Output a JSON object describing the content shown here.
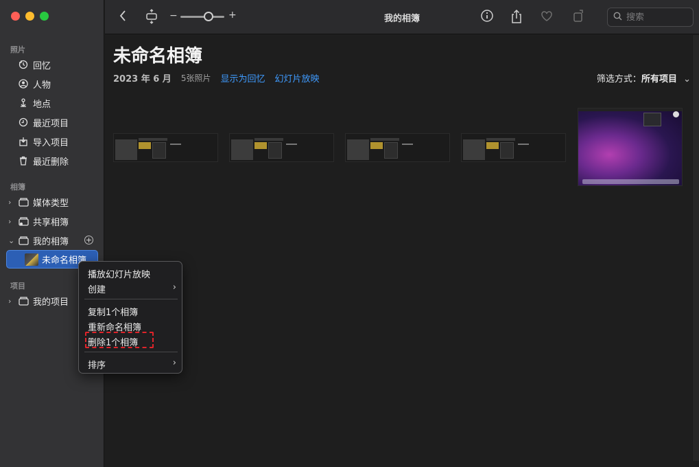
{
  "window": {
    "title": "我的相簿"
  },
  "sidebar": {
    "section_photos": "照片",
    "photos_items": [
      {
        "label": "回忆",
        "icon": "memories-icon"
      },
      {
        "label": "人物",
        "icon": "people-icon"
      },
      {
        "label": "地点",
        "icon": "places-icon"
      },
      {
        "label": "最近项目",
        "icon": "recent-icon"
      },
      {
        "label": "导入项目",
        "icon": "import-icon"
      },
      {
        "label": "最近删除",
        "icon": "trash-icon"
      }
    ],
    "section_albums": "相簿",
    "album_items": [
      {
        "label": "媒体类型"
      },
      {
        "label": "共享相簿"
      },
      {
        "label": "我的相簿"
      }
    ],
    "selected_album": "未命名相簿",
    "section_projects": "项目",
    "project_items": [
      {
        "label": "我的项目"
      }
    ]
  },
  "toolbar": {
    "zoom_minus": "−",
    "zoom_plus": "+",
    "search_placeholder": "搜索"
  },
  "content": {
    "album_title": "未命名相簿",
    "date": "2023 年 6 月",
    "count": "5张照片",
    "show_as_memory": "显示为回忆",
    "slideshow": "幻灯片放映",
    "filter_label": "筛选方式：",
    "filter_value": "所有项目"
  },
  "context_menu": {
    "play_slideshow": "播放幻灯片放映",
    "create": "创建",
    "duplicate": "复制1个相簿",
    "rename": "重新命名相簿",
    "delete": "删除1个相簿",
    "sort": "排序"
  },
  "colors": {
    "accent": "#3f9bff",
    "selection": "#2c5fb5",
    "highlight_dash": "#e0242a"
  }
}
